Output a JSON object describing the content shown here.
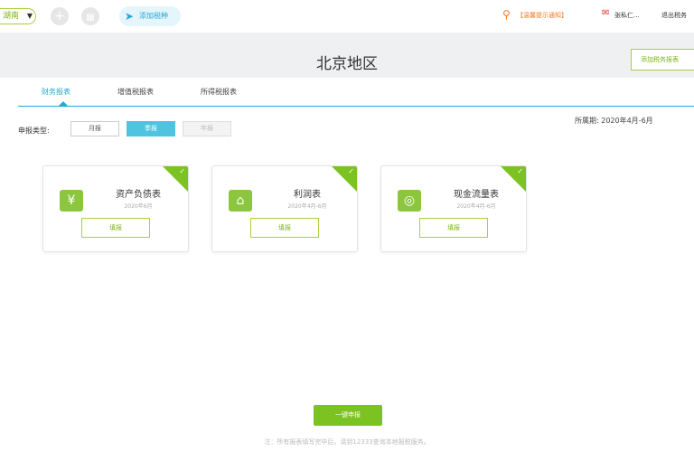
{
  "topbar": {
    "region": "湖南",
    "add_label": "添加税种",
    "notice": "【温馨提示通知】",
    "user": "张私仁...",
    "user2": "退出税务"
  },
  "page": {
    "title": "北京地区",
    "add_button": "添加税务报表"
  },
  "tabs": [
    {
      "label": "财务报表"
    },
    {
      "label": "增值税报表"
    },
    {
      "label": "所得税报表"
    }
  ],
  "filter": {
    "label": "申报类型:",
    "options": [
      {
        "label": "月报"
      },
      {
        "label": "季报"
      },
      {
        "label": "年报"
      }
    ],
    "period": "所属期: 2020年4月-6月"
  },
  "cards": [
    {
      "title": "资产负债表",
      "date": "2020年6月",
      "button": "填报",
      "icon": "yen-icon"
    },
    {
      "title": "利润表",
      "date": "2020年4月-6月",
      "button": "填报",
      "icon": "store-icon"
    },
    {
      "title": "现金流量表",
      "date": "2020年4月-6月",
      "button": "填报",
      "icon": "cash-flow-icon"
    }
  ],
  "submit_button": "一键申报",
  "footnote": "注：所有报表填写完毕后，请到12333查询本地报税服务。",
  "colors": {
    "accent_green": "#7cc220",
    "accent_blue": "#29a7d7",
    "notice_orange": "#f07a2a"
  }
}
